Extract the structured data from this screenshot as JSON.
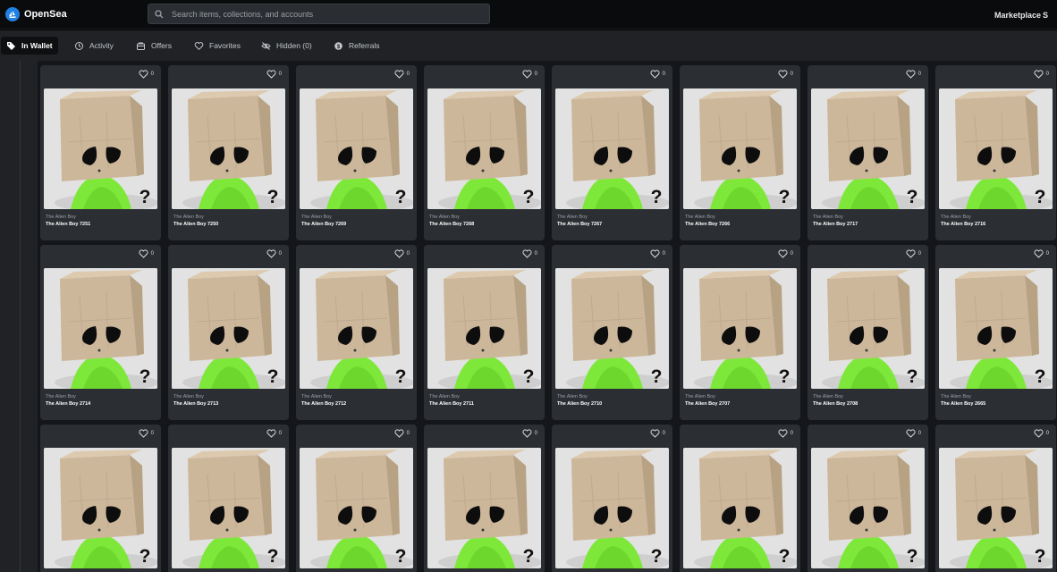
{
  "header": {
    "brand": "OpenSea",
    "search_placeholder": "Search items, collections, and accounts",
    "nav": [
      "Marketplace",
      "S"
    ]
  },
  "tabs": [
    {
      "label": "In Wallet",
      "icon": "wallet-tag-icon",
      "active": true
    },
    {
      "label": "Activity",
      "icon": "history-icon",
      "active": false
    },
    {
      "label": "Offers",
      "icon": "offers-icon",
      "active": false
    },
    {
      "label": "Favorites",
      "icon": "heart-icon",
      "active": false
    },
    {
      "label": "Hidden (0)",
      "icon": "eye-off-icon",
      "active": false
    },
    {
      "label": "Referrals",
      "icon": "referrals-icon",
      "active": false
    }
  ],
  "grid": {
    "collection": "The Alien Boy",
    "rows": [
      [
        {
          "name": "The Alien Boy 7251",
          "favorites": "0"
        },
        {
          "name": "The Alien Boy 7250",
          "favorites": "0"
        },
        {
          "name": "The Alien Boy 7269",
          "favorites": "0"
        },
        {
          "name": "The Alien Boy 7268",
          "favorites": "0"
        },
        {
          "name": "The Alien Boy 7267",
          "favorites": "0"
        },
        {
          "name": "The Alien Boy 7266",
          "favorites": "0"
        },
        {
          "name": "The Alien Boy 2717",
          "favorites": "0"
        },
        {
          "name": "The Alien Boy 2716",
          "favorites": "0"
        }
      ],
      [
        {
          "name": "The Alien Boy 2714",
          "favorites": "0"
        },
        {
          "name": "The Alien Boy 2713",
          "favorites": "0"
        },
        {
          "name": "The Alien Boy 2712",
          "favorites": "0"
        },
        {
          "name": "The Alien Boy 2711",
          "favorites": "0"
        },
        {
          "name": "The Alien Boy 2710",
          "favorites": "0"
        },
        {
          "name": "The Alien Boy 2707",
          "favorites": "0"
        },
        {
          "name": "The Alien Boy 2708",
          "favorites": "0"
        },
        {
          "name": "The Alien Boy 2665",
          "favorites": "0"
        }
      ],
      [
        {
          "name": "",
          "favorites": "0"
        },
        {
          "name": "",
          "favorites": "0"
        },
        {
          "name": "",
          "favorites": "0"
        },
        {
          "name": "",
          "favorites": "0"
        },
        {
          "name": "",
          "favorites": "0"
        },
        {
          "name": "",
          "favorites": "0"
        },
        {
          "name": "",
          "favorites": "0"
        },
        {
          "name": "",
          "favorites": "0"
        }
      ]
    ]
  },
  "colors": {
    "background": "#141619",
    "card": "#2b2e33",
    "brand": "#2081e2",
    "bag": "#cdb79b",
    "alien_body": "#7ee83a"
  }
}
